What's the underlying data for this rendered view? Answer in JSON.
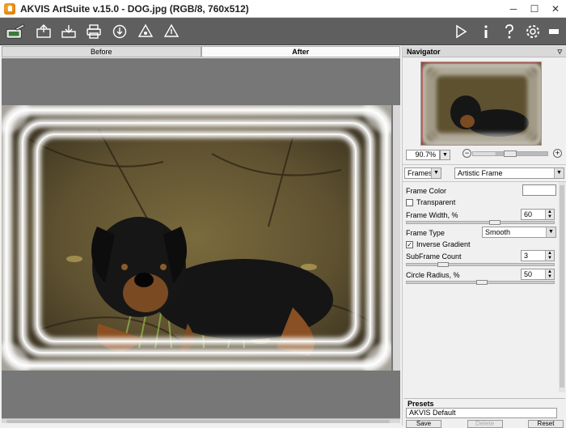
{
  "window": {
    "title": "AKVIS ArtSuite v.15.0 - DOG.jpg (RGB/8, 760x512)",
    "minimize": "─",
    "maximize": "☐",
    "close": "✕"
  },
  "toolbar": {
    "left_icons": [
      "artsuite-logo-icon",
      "open-icon",
      "save-icon",
      "print-icon",
      "share-icon",
      "batch-icon",
      "plugin-icon"
    ],
    "right_icons": [
      "run-icon",
      "info-icon",
      "help-icon",
      "settings-icon",
      "minimize-panel-icon"
    ]
  },
  "tabs": [
    {
      "label": "Before"
    },
    {
      "label": "After"
    }
  ],
  "navigator": {
    "title": "Navigator",
    "zoom": "90.7%",
    "zoom_out": "−",
    "zoom_in": "+"
  },
  "effect": {
    "category": "Frames",
    "effect": "Artistic Frame"
  },
  "params": {
    "frame_color_label": "Frame Color",
    "transparent_label": "Transparent",
    "frame_width_label": "Frame Width, %",
    "frame_width_value": "60",
    "frame_type_label": "Frame Type",
    "frame_type_value": "Smooth",
    "inverse_gradient_label": "Inverse Gradient",
    "inverse_gradient_check": "✓",
    "subframe_count_label": "SubFrame Count",
    "subframe_count_value": "3",
    "circle_radius_label": "Circle Radius, %",
    "circle_radius_value": "50"
  },
  "presets": {
    "title": "Presets",
    "selected": "AKVIS Default",
    "save": "Save",
    "delete": "Delete",
    "reset": "Reset"
  },
  "colors": {
    "toolbar": "#5f5f5f",
    "canvas": "#777777",
    "frame": "#ffffff"
  }
}
